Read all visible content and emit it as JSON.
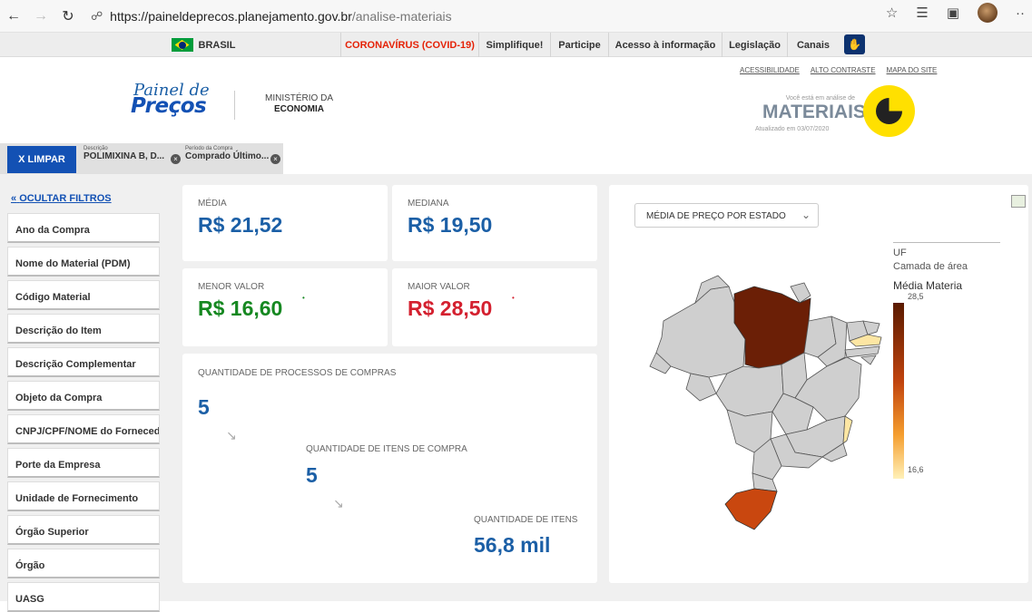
{
  "browser": {
    "back_icon": "arrow-left-icon",
    "forward_icon": "arrow-right-icon",
    "refresh_icon": "refresh-icon",
    "lock_icon": "lock-icon",
    "url_host": "https://paineldeprecos.planejamento.gov.br",
    "url_path": "/analise-materiais"
  },
  "gov_bar": {
    "brasil": "BRASIL",
    "covid": "CORONAVÍRUS (COVID-19)",
    "simplifique": "Simplifique!",
    "participe": "Participe",
    "acesso": "Acesso à informação",
    "legislacao": "Legislação",
    "canais": "Canais"
  },
  "header": {
    "logo_top": "Painel de",
    "logo_bottom": "Preços",
    "ministry_line1": "MINISTÉRIO DA",
    "ministry_line2": "ECONOMIA",
    "link_acessibilidade": "ACESSIBILIDADE",
    "link_contraste": "ALTO CONTRASTE",
    "link_mapa": "MAPA DO SITE",
    "analise_small": "Você está em análise de",
    "analise_big": "MATERIAIS",
    "updated": "Atualizado em 03/07/2020"
  },
  "filters": {
    "clear": "X  LIMPAR",
    "chip1_label": "Descrição",
    "chip1_value": "POLIMIXINA B, D...",
    "chip2_label": "Período da Compra",
    "chip2_value": "Comprado Último..."
  },
  "sidebar": {
    "hide": "OCULTAR FILTROS",
    "items": [
      "Ano da Compra",
      "Nome do Material (PDM)",
      "Código Material",
      "Descrição do Item",
      "Descrição Complementar",
      "Objeto da Compra",
      "CNPJ/CPF/NOME do Fornecedor",
      "Porte da Empresa",
      "Unidade de Fornecimento",
      "Órgão Superior",
      "Órgão",
      "UASG"
    ]
  },
  "stats": {
    "media_label": "MÉDIA",
    "media_value": "R$ 21,52",
    "mediana_label": "MEDIANA",
    "mediana_value": "R$ 19,50",
    "menor_label": "MENOR VALOR",
    "menor_value": "R$ 16,60",
    "maior_label": "MAIOR VALOR",
    "maior_value": "R$ 28,50"
  },
  "quantities": {
    "processos_label": "QUANTIDADE DE PROCESSOS DE COMPRAS",
    "processos_value": "5",
    "itens_compra_label": "QUANTIDADE DE ITENS DE COMPRA",
    "itens_compra_value": "5",
    "itens_label": "QUANTIDADE DE ITENS",
    "itens_value": "56,8 mil"
  },
  "map": {
    "select_label": "MÉDIA DE PREÇO POR ESTADO",
    "legend_uf": "UF",
    "legend_layer": "Camada de área",
    "legend_title": "Média Materia",
    "legend_max": "28,5",
    "legend_min": "16,6",
    "colors": {
      "default": "#cfcfcf",
      "para": "#6b1f06",
      "rs": "#c9470f",
      "light": "#fde6a3"
    }
  }
}
